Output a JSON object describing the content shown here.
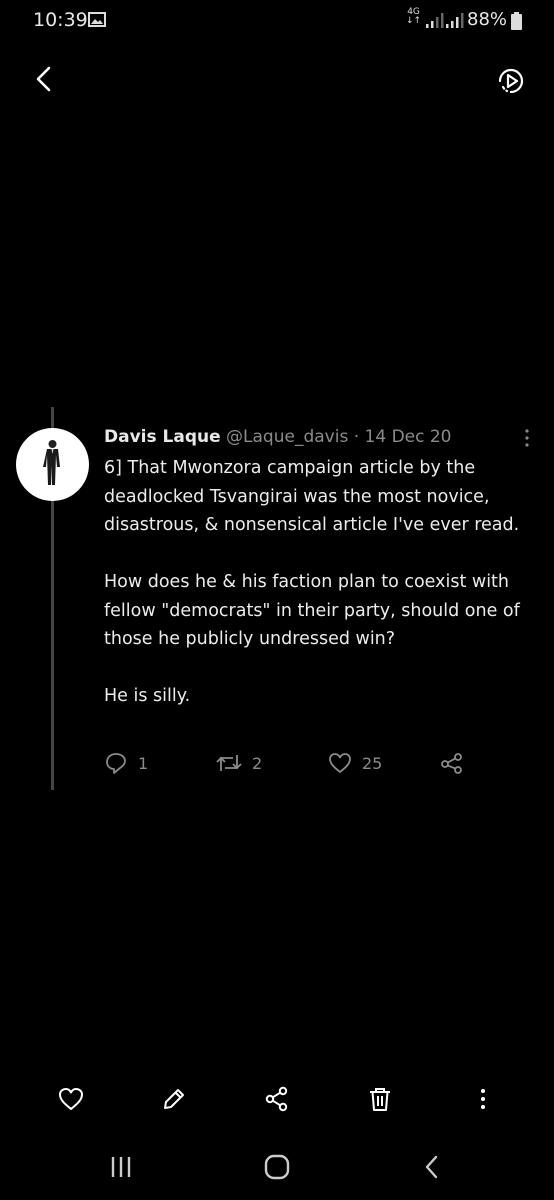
{
  "status": {
    "time": "10:39",
    "network_type": "4G",
    "battery": "88%"
  },
  "tweet": {
    "author_name": "Davis Laque",
    "handle": "@Laque_davis",
    "separator": "·",
    "date": "14 Dec 20",
    "paragraphs": [
      "6] That Mwonzora campaign article by the deadlocked Tsvangirai was the most novice, disastrous, & nonsensical article I've ever read.",
      "How does he & his faction plan to coexist with fellow \"democrats\" in their party, should one of those he publicly undressed win?",
      "He is silly."
    ],
    "replies": "1",
    "retweets": "2",
    "likes": "25"
  },
  "icons": {
    "top": [
      "back-icon",
      "media-play-icon"
    ],
    "tweet": [
      "more-vertical-icon",
      "reply-icon",
      "retweet-icon",
      "like-icon",
      "share-icon"
    ],
    "toolbar": [
      "heart-icon",
      "edit-icon",
      "share-icon",
      "delete-icon",
      "more-vertical-icon"
    ],
    "navigation": [
      "recent-apps-icon",
      "home-icon",
      "back-icon"
    ]
  }
}
